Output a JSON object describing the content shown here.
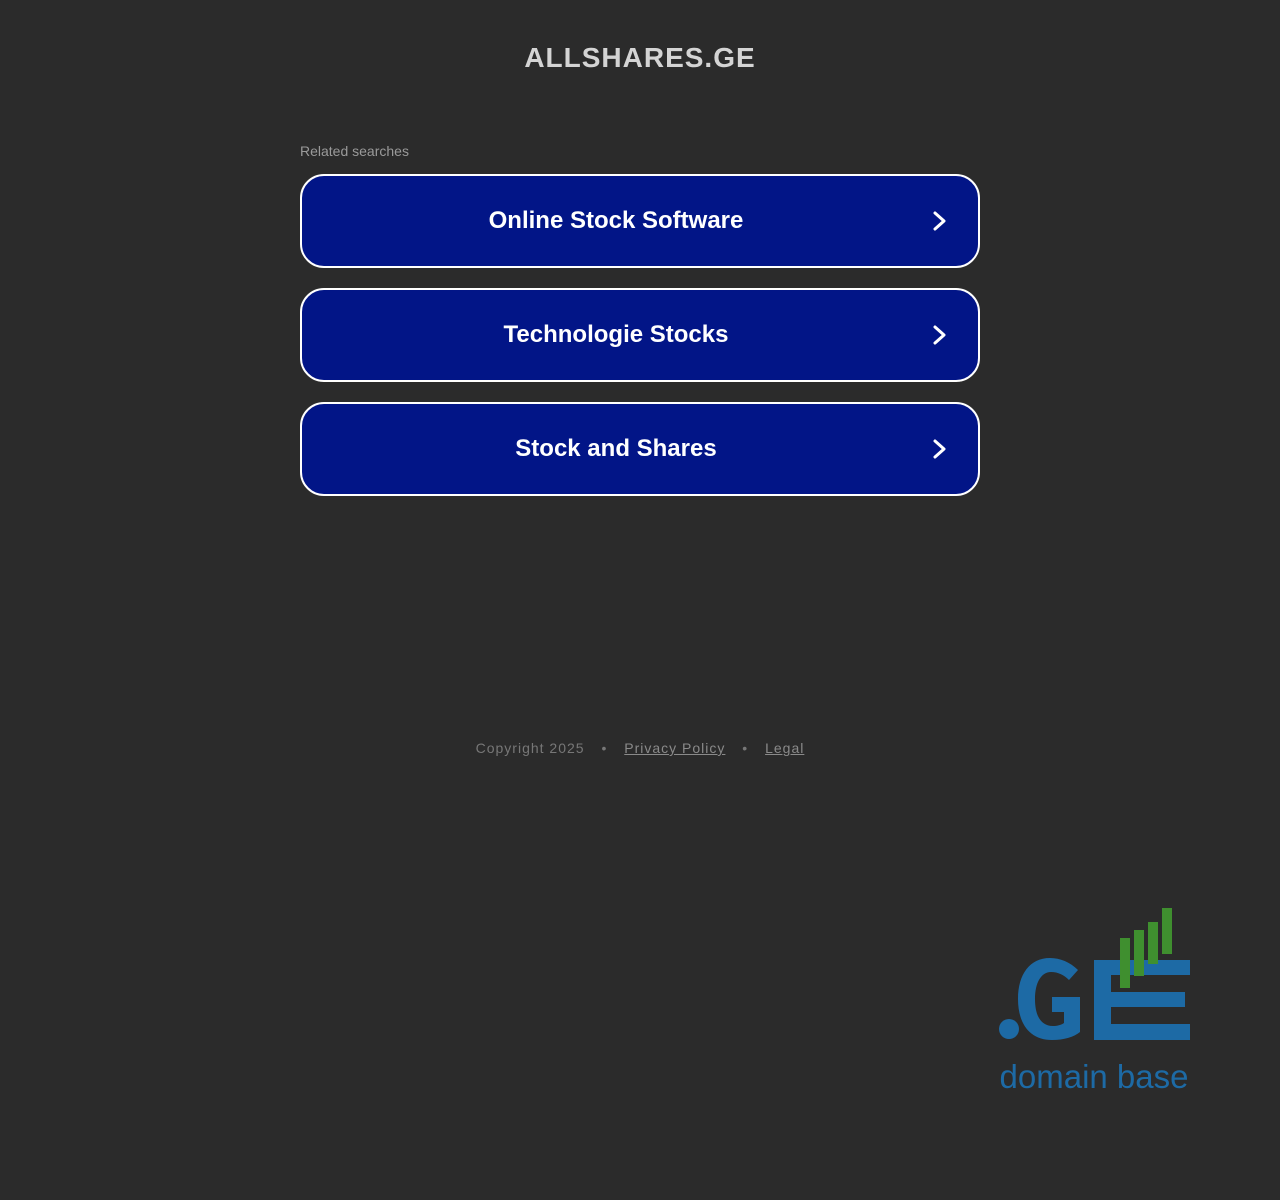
{
  "header": {
    "site_title": "ALLSHARES.GE"
  },
  "related": {
    "label": "Related searches",
    "items": [
      {
        "label": "Online Stock Software",
        "icon": "chevron-right-icon"
      },
      {
        "label": "Technologie Stocks",
        "icon": "chevron-right-icon"
      },
      {
        "label": "Stock and Shares",
        "icon": "chevron-right-icon"
      }
    ]
  },
  "footer": {
    "copyright": "Copyright 2025",
    "separator": "•",
    "privacy_label": "Privacy Policy",
    "legal_label": "Legal"
  },
  "logo": {
    "mark": ".GE",
    "tagline": "domain base"
  },
  "colors": {
    "background": "#2b2b2b",
    "button_bg": "#021587",
    "button_border": "#ffffff",
    "logo_blue": "#1d6aa5",
    "logo_green": "#3f8f2f"
  }
}
